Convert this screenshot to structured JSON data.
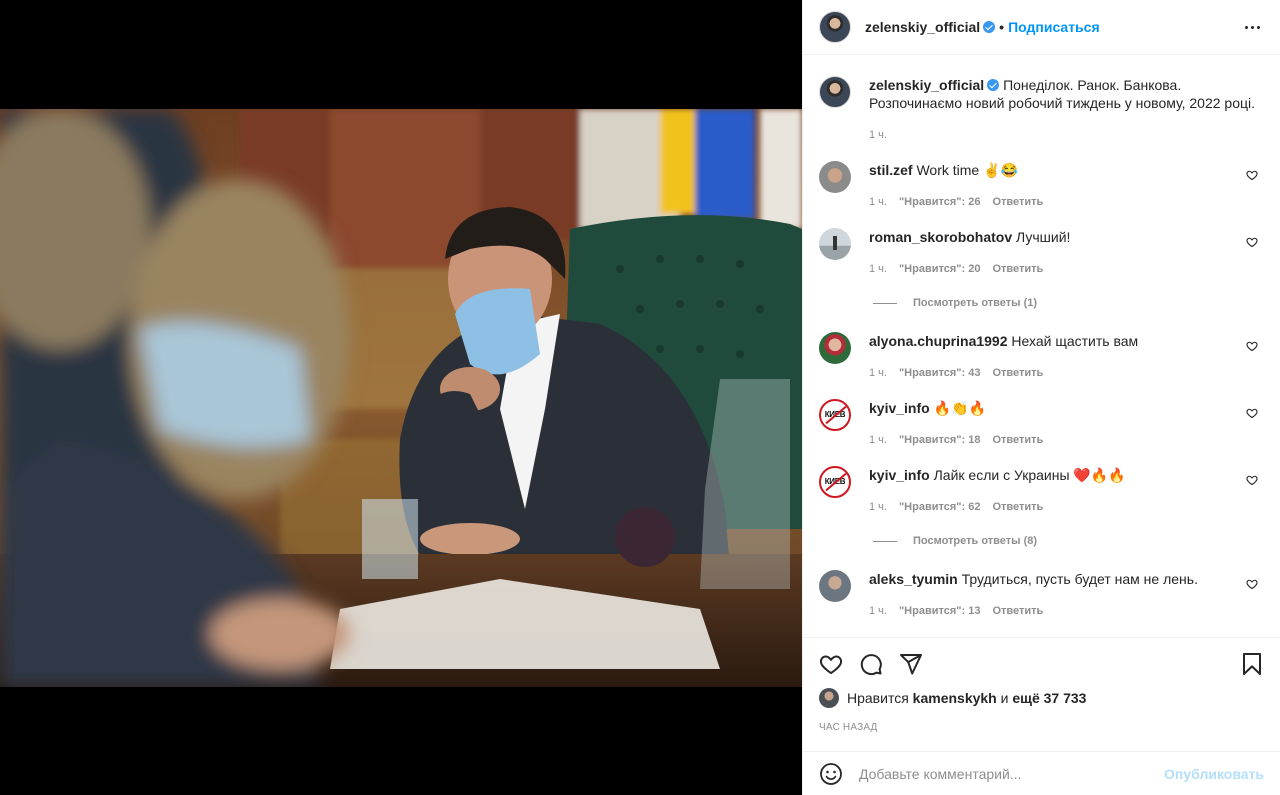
{
  "post_header": {
    "username": "zelenskiy_official",
    "separator": "•",
    "follow_label": "Подписаться"
  },
  "caption": {
    "username": "zelenskiy_official",
    "text": "Понеділок. Ранок. Банкова. Розпочинаємо новий робочий тиждень у новому, 2022 році.",
    "time": "1 ч."
  },
  "comments": [
    {
      "username": "stil.zef",
      "text": "Work time ✌️😂",
      "time": "1 ч.",
      "likes": "\"Нравится\": 26",
      "reply": "Ответить"
    },
    {
      "username": "roman_skorobohatov",
      "text": "Лучший!",
      "time": "1 ч.",
      "likes": "\"Нравится\": 20",
      "reply": "Ответить",
      "view_replies": "Посмотреть ответы (1)"
    },
    {
      "username": "alyona.chuprina1992",
      "text": "Нехай щастить вам",
      "time": "1 ч.",
      "likes": "\"Нравится\": 43",
      "reply": "Ответить"
    },
    {
      "username": "kyiv_info",
      "text": "🔥👏🔥",
      "time": "1 ч.",
      "likes": "\"Нравится\": 18",
      "reply": "Ответить",
      "avatar_text": "КИЕВ"
    },
    {
      "username": "kyiv_info",
      "text": "Лайк если с Украины ❤️🔥🔥",
      "time": "1 ч.",
      "likes": "\"Нравится\": 62",
      "reply": "Ответить",
      "view_replies": "Посмотреть ответы (8)",
      "avatar_text": "КИЕВ"
    },
    {
      "username": "aleks_tyumin",
      "text": "Трудиться, пусть будет нам не лень.",
      "time": "1 ч.",
      "likes": "\"Нравится\": 13",
      "reply": "Ответить"
    }
  ],
  "likes_line": {
    "prefix": "Нравится",
    "user": "kamenskykh",
    "connector": "и",
    "others": "ещё 37 733"
  },
  "time_ago": "час назад",
  "add_comment": {
    "placeholder": "Добавьте комментарий...",
    "publish_label": "Опубликовать"
  },
  "colors": {
    "link_blue": "#0095f6",
    "verified_blue": "#3897f0",
    "publish_disabled": "#b2dffc",
    "muted_text": "#8e8e8e"
  },
  "icons": [
    "more-icon",
    "verified-icon",
    "heart-icon",
    "comment-icon",
    "share-icon",
    "bookmark-icon",
    "emoji-icon"
  ]
}
